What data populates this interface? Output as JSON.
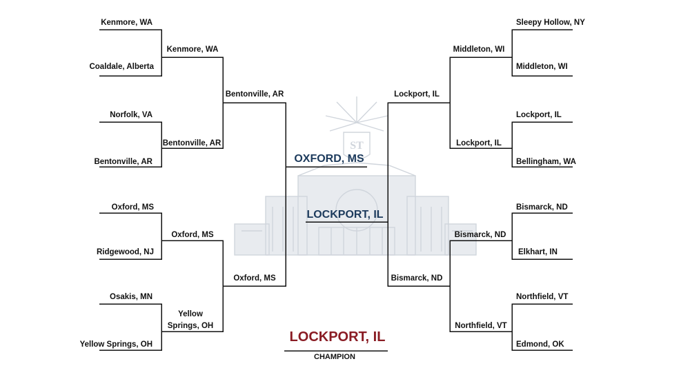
{
  "champion": {
    "team": "LOCKPORT, IL",
    "label": "CHAMPION"
  },
  "finalists": {
    "left": "OXFORD, MS",
    "right": "LOCKPORT, IL"
  },
  "left": {
    "round1": [
      "Kenmore, WA",
      "Coaldale, Alberta",
      "Norfolk, VA",
      "Bentonville, AR",
      "Oxford, MS",
      "Ridgewood, NJ",
      "Osakis, MN",
      "Yellow Springs, OH"
    ],
    "round2": [
      "Kenmore, WA",
      "Bentonville, AR",
      "Oxford, MS",
      "Yellow Springs, OH"
    ],
    "round3": [
      "Bentonville, AR",
      "Oxford, MS"
    ]
  },
  "right": {
    "round1": [
      "Sleepy Hollow, NY",
      "Middleton, WI",
      "Lockport, IL",
      "Bellingham, WA",
      "Bismarck, ND",
      "Elkhart, IN",
      "Northfield, VT",
      "Edmond, OK"
    ],
    "round2": [
      "Middleton, WI",
      "Lockport, IL",
      "Bismarck, ND",
      "Northfield, VT"
    ],
    "round3": [
      "Lockport, IL",
      "Bismarck, ND"
    ]
  },
  "colors": {
    "finalist": "#1c3a5c",
    "champion": "#8a1c24",
    "watermark": "#c8ced6"
  }
}
